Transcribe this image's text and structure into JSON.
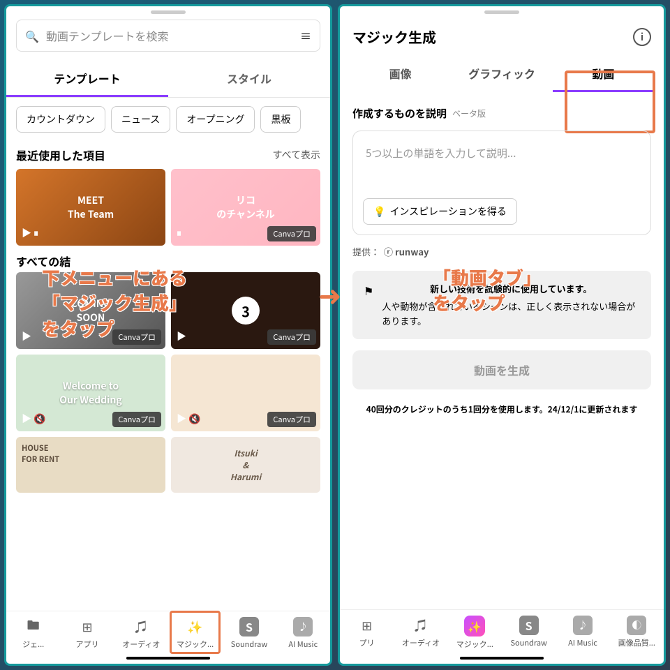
{
  "left": {
    "search_placeholder": "動画テンプレートを検索",
    "tabs": [
      "テンプレート",
      "スタイル"
    ],
    "chips": [
      "カウントダウン",
      "ニュース",
      "オープニング",
      "黒板"
    ],
    "recent_label": "最近使用した項目",
    "show_all": "すべて表示",
    "all_results_label": "すべての結",
    "pro_badge": "Canvaプロ",
    "cards": {
      "meet": "MEET\nThe Team",
      "riko": "リコ\nのチャンネル",
      "coming": "COMING\nSOON",
      "num": "3",
      "wedding": "Welcome to\nOur Wedding",
      "house": "HOUSE\nFOR RENT",
      "names": "Itsuki\n&\nHarumi"
    },
    "nav": [
      "ジェ...",
      "アプリ",
      "オーディオ",
      "マジック...",
      "Soundraw",
      "AI Music"
    ]
  },
  "right": {
    "title": "マジック生成",
    "tabs": [
      "画像",
      "グラフィック",
      "動画"
    ],
    "desc_label": "作成するものを説明",
    "beta": "ベータ版",
    "input_placeholder": "5つ以上の単語を入力して説明...",
    "inspiration": "インスピレーションを得る",
    "provider_label": "提供：",
    "provider_name": "runway",
    "warn_title": "新しい技術を試験的に使用しています。",
    "warn_body": "人や動物が含まれているシーンは、正しく表示されない場合があります。",
    "generate": "動画を生成",
    "credit": "40回分のクレジットのうち1回分を使用します。24/12/1に更新されます",
    "nav": [
      "プリ",
      "オーディオ",
      "マジック...",
      "Soundraw",
      "AI Music",
      "画像品質..."
    ]
  },
  "annotations": {
    "a1": "下メニューにある\n「マジック生成」\nをタップ",
    "a2": "「動画タブ」\nをタップ"
  }
}
